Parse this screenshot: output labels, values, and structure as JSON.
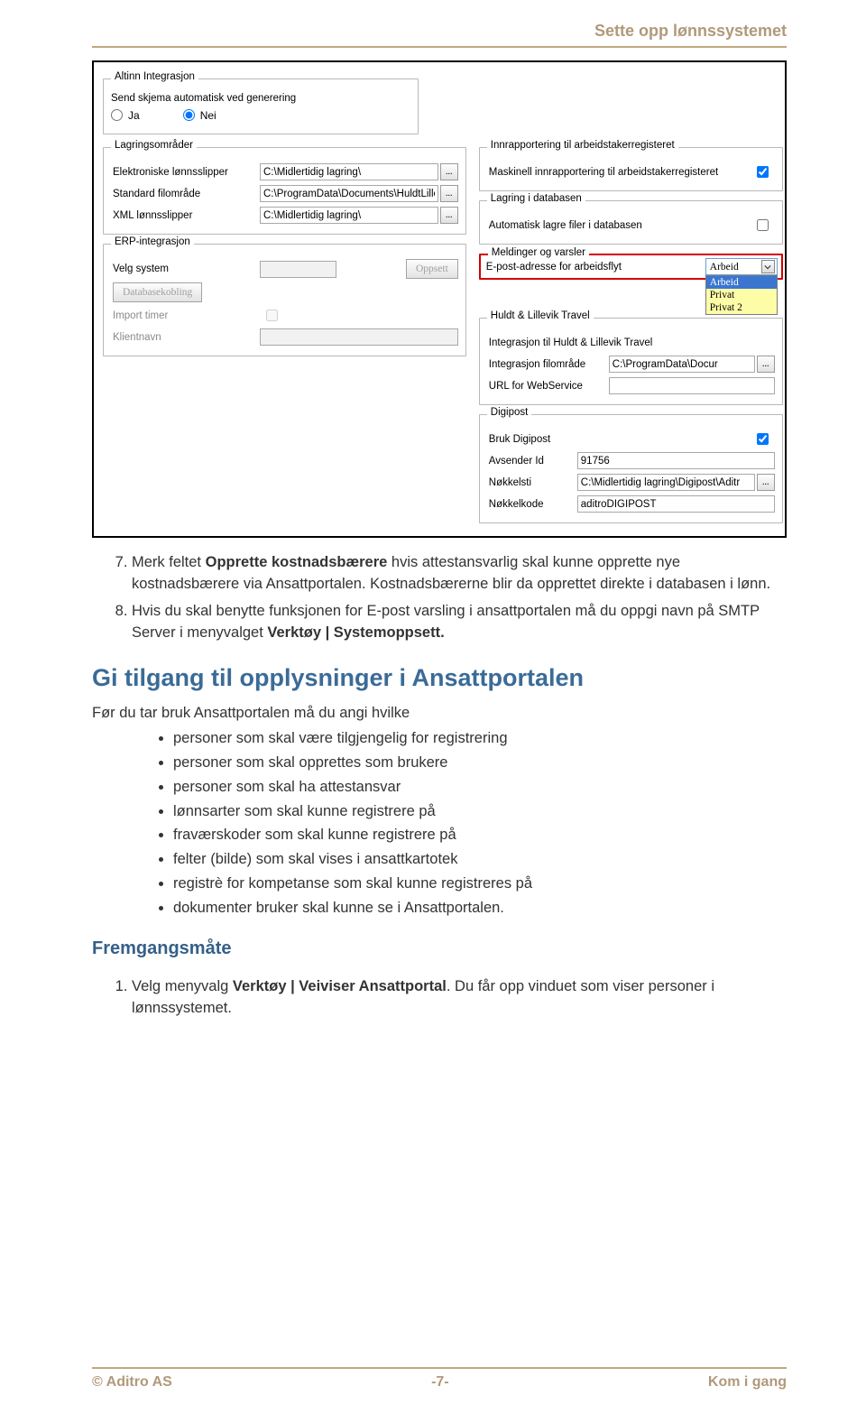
{
  "header": {
    "title": "Sette opp lønnssystemet"
  },
  "screenshot": {
    "altinn": {
      "legend": "Altinn Integrasjon",
      "prompt": "Send skjema automatisk ved generering",
      "ja": "Ja",
      "nei": "Nei"
    },
    "lagring": {
      "legend": "Lagringsområder",
      "elabel": "Elektroniske lønnsslipper",
      "evalue": "C:\\Midlertidig lagring\\",
      "slabel": "Standard filområde",
      "svalue": "C:\\ProgramData\\Documents\\HuldtLille\\",
      "xlabel": "XML lønnsslipper",
      "xvalue": "C:\\Midlertidig lagring\\"
    },
    "erp": {
      "legend": "ERP-integrasjon",
      "velg": "Velg system",
      "oppsett": "Oppsett",
      "dbk": "Databasekobling",
      "imp": "Import timer",
      "klient": "Klientnavn"
    },
    "right": {
      "innrapp": "Innrapportering til arbeidstakerregisteret",
      "mask": "Maskinell innrapportering til arbeidstakerregisteret",
      "lagrdb": "Lagring i databasen",
      "autolagr": "Automatisk lagre filer i databasen",
      "meldinger": "Meldinger og varsler",
      "epost": "E-post-adresse for arbeidsflyt",
      "dd_value": "Arbeid",
      "opts": [
        "Arbeid",
        "Privat",
        "Privat 2"
      ],
      "hl": "Huldt & Lillevik Travel",
      "hlint": "Integrasjon til Huldt & Lillevik Travel",
      "intfil": "Integrasjon filområde",
      "intfil_val": "C:\\ProgramData\\Docur",
      "urlws": "URL for WebService",
      "digipost": "Digipost",
      "brukdigi": "Bruk Digipost",
      "avsender": "Avsender Id",
      "avsender_val": "91756",
      "nokkelsti": "Nøkkelsti",
      "nokkelsti_val": "C:\\Midlertidig lagring\\Digipost\\Aditr",
      "nokkelkode": "Nøkkelkode",
      "nokkelkode_val": "aditroDIGIPOST"
    }
  },
  "body": {
    "step7_a": "Merk feltet ",
    "step7_b": "Opprette kostnadsbærere",
    "step7_c": " hvis attestansvarlig skal kunne opprette nye kostnadsbærere via Ansattportalen. Kostnadsbærerne blir da opprettet direkte i databasen i lønn.",
    "step8_a": "Hvis du skal benytte funksjonen for E-post varsling i ansattportalen må du oppgi navn på SMTP Server i menyvalget ",
    "step8_b": "Verktøy | Systemoppsett.",
    "h2": "Gi tilgang til opplysninger i Ansattportalen",
    "intro": "Før du tar bruk Ansattportalen må du angi hvilke",
    "bullets": [
      "personer som skal være tilgjengelig for registrering",
      "personer som skal opprettes som brukere",
      "personer som skal ha attestansvar",
      "lønnsarter som skal kunne registrere på",
      "fraværskoder som skal kunne registrere på",
      "felter (bilde) som skal vises i ansattkartotek",
      "registrè for kompetanse som skal kunne registreres på",
      "dokumenter bruker skal kunne se i Ansattportalen."
    ],
    "frem": "Fremgangsmåte",
    "step1_a": "Velg menyvalg ",
    "step1_b": "Verktøy | Veiviser Ansattportal",
    "step1_c": ". Du får opp vinduet som viser personer i lønnssystemet."
  },
  "footer": {
    "left": "© Aditro AS",
    "center": "-7-",
    "right": "Kom i gang"
  }
}
